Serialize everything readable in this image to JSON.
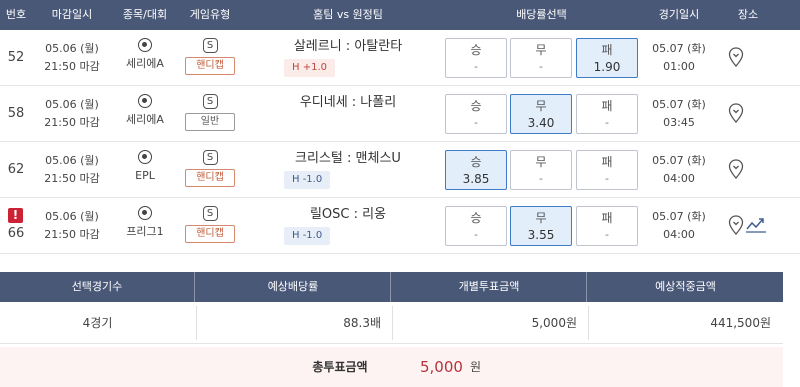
{
  "table_header": [
    "번호",
    "마감일시",
    "종목/대회",
    "게임유형",
    "홈팀 vs 원정팀",
    "배당률선택",
    "경기일시",
    "장소"
  ],
  "rows": [
    {
      "no": "52",
      "deadline_date": "05.06 (월)",
      "deadline_time": "21:50 마감",
      "league": "세리에A",
      "game_icon": "S",
      "game_type": "핸디캡",
      "teams": "살레르니 : 아탈란타",
      "handicap": "H +1.0",
      "win_label": "승",
      "win_value": "-",
      "draw_label": "무",
      "draw_value": "-",
      "lose_label": "패",
      "lose_value": "1.90",
      "selected": "lose",
      "match_date": "05.07 (화)",
      "match_time": "01:00",
      "alert": false
    },
    {
      "no": "58",
      "deadline_date": "05.06 (월)",
      "deadline_time": "21:50 마감",
      "league": "세리에A",
      "game_icon": "S",
      "game_type": "일반",
      "teams": "우디네세 : 나폴리",
      "handicap": "",
      "win_label": "승",
      "win_value": "-",
      "draw_label": "무",
      "draw_value": "3.40",
      "lose_label": "패",
      "lose_value": "-",
      "selected": "draw",
      "match_date": "05.07 (화)",
      "match_time": "03:45",
      "alert": false
    },
    {
      "no": "62",
      "deadline_date": "05.06 (월)",
      "deadline_time": "21:50 마감",
      "league": "EPL",
      "game_icon": "S",
      "game_type": "핸디캡",
      "teams": "크리스털 : 맨체스U",
      "handicap": "H -1.0",
      "win_label": "승",
      "win_value": "3.85",
      "draw_label": "무",
      "draw_value": "-",
      "lose_label": "패",
      "lose_value": "-",
      "selected": "win",
      "match_date": "05.07 (화)",
      "match_time": "04:00",
      "alert": false
    },
    {
      "no": "66",
      "deadline_date": "05.06 (월)",
      "deadline_time": "21:50 마감",
      "league": "프리그1",
      "game_icon": "S",
      "game_type": "핸디캡",
      "teams": "릴OSC : 리옹",
      "handicap": "H -1.0",
      "win_label": "승",
      "win_value": "-",
      "draw_label": "무",
      "draw_value": "3.55",
      "lose_label": "패",
      "lose_value": "-",
      "selected": "draw",
      "match_date": "05.07 (화)",
      "match_time": "04:00",
      "alert": true,
      "alert_mark": "!"
    }
  ],
  "summary": {
    "headers": [
      "선택경기수",
      "예상배당률",
      "개별투표금액",
      "예상적중금액"
    ],
    "values": [
      "4경기",
      "88.3배",
      "5,000원",
      "441,500원"
    ]
  },
  "total": {
    "label": "총투표금액",
    "amount": "5,000",
    "unit": "원"
  },
  "colors": {
    "header_bg": "#4a5878",
    "selected_bg": "#e3eefb",
    "selected_border": "#3f7bc9",
    "handicap_badge": "#c05a3a",
    "total_amount": "#b8323a",
    "total_bg": "#fdf3f3",
    "alert": "#cc2233"
  },
  "icons": {
    "league": "soccer-ball-icon",
    "game": "s-icon",
    "venue": "map-pin-icon",
    "trend": "trend-chart-icon",
    "alert": "alert-icon"
  }
}
